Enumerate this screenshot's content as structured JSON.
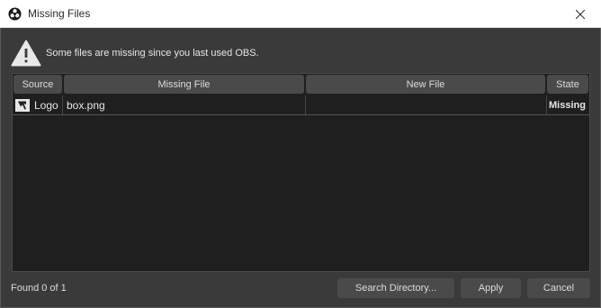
{
  "window": {
    "title": "Missing Files",
    "app_icon": "obs-logo-icon",
    "close_icon": "close-icon"
  },
  "warning": {
    "icon": "warning-icon",
    "message": "Some files are missing since you last used OBS."
  },
  "table": {
    "columns": [
      "Source",
      "Missing File",
      "New File",
      "State"
    ],
    "rows": [
      {
        "source_icon": "image-source-icon",
        "source": "Logo",
        "missing_file": "box.png",
        "new_file": "",
        "state": "Missing"
      }
    ]
  },
  "footer": {
    "status": "Found 0 of 1",
    "search_directory_label": "Search Directory...",
    "apply_label": "Apply",
    "cancel_label": "Cancel"
  },
  "colors": {
    "background": "#3a3a3a",
    "table_background": "#1f1f1f",
    "button_background": "#4a4a4a",
    "text": "#dcdcdc"
  }
}
